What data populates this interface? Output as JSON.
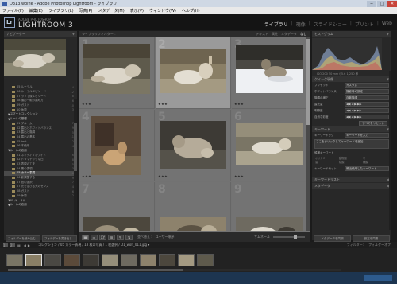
{
  "window": {
    "title": "D313.wolfie - Adobe Photoshop Lightroom - ライブラリ",
    "minimize": "─",
    "maximize": "□",
    "close": "✕"
  },
  "menu": [
    "ファイル(F)",
    "編集(E)",
    "ライブラリ(L)",
    "写真(P)",
    "メタデータ(M)",
    "表示(V)",
    "ウィンドウ(W)",
    "ヘルプ(H)"
  ],
  "identity": {
    "badge": "Lr",
    "vendor": "ADOBE PHOTOSHOP",
    "product": "LIGHTROOM 3"
  },
  "modules": [
    {
      "label": "ライブラリ",
      "active": true
    },
    {
      "label": "現像",
      "active": false
    },
    {
      "label": "スライドショー",
      "active": false
    },
    {
      "label": "プリント",
      "active": false
    },
    {
      "label": "Web",
      "active": false
    }
  ],
  "left_panel": {
    "navigator_title": "ナビゲーター",
    "folders": [
      {
        "label": "05 ルーラル",
        "count": "4",
        "kind": "folder"
      },
      {
        "label": "06 ルーラルエビゾード",
        "count": "12",
        "kind": "folder"
      },
      {
        "label": "07 ラフで後エビゾード",
        "count": "8",
        "kind": "folder"
      },
      {
        "label": "08 撮影一眼の始め方",
        "count": "6",
        "kind": "folder"
      },
      {
        "label": "09 ガスト",
        "count": "10",
        "kind": "folder"
      },
      {
        "label": "10 休憩",
        "count": "3",
        "kind": "folder"
      },
      {
        "label": "スマートコレクション",
        "count": "",
        "kind": "group"
      },
      {
        "label": "ルールの基礎",
        "count": "",
        "kind": "group"
      },
      {
        "label": "01 ブルーム",
        "count": "7",
        "kind": "folder"
      },
      {
        "label": "02 露出とホワイトバランス",
        "count": "9",
        "kind": "folder"
      },
      {
        "label": "03 露出と階調",
        "count": "5",
        "kind": "folder"
      },
      {
        "label": "04 露出の基本",
        "count": "11",
        "kind": "folder"
      },
      {
        "label": "05 text",
        "count": "2",
        "kind": "folder"
      },
      {
        "label": "06 本使用",
        "count": "4",
        "kind": "folder"
      },
      {
        "label": "ルールの応用",
        "count": "",
        "kind": "group"
      },
      {
        "label": "01 ネイティブホワイト",
        "count": "6",
        "kind": "folder"
      },
      {
        "label": "02 ドラマチックな白",
        "count": "8",
        "kind": "folder"
      },
      {
        "label": "03 表現の工夫",
        "count": "5",
        "kind": "folder"
      },
      {
        "label": "04 黒の表現",
        "count": "3",
        "kind": "folder"
      },
      {
        "label": "05 カラー表現",
        "count": "18",
        "kind": "folder",
        "selected": true
      },
      {
        "label": "06 影調整する",
        "count": "9",
        "kind": "folder"
      },
      {
        "label": "07 色の選択",
        "count": "7",
        "kind": "folder"
      },
      {
        "label": "07 光を浴びる光のセンス",
        "count": "4",
        "kind": "folder"
      },
      {
        "label": "08 ガスト",
        "count": "6",
        "kind": "folder"
      },
      {
        "label": "09 休憩",
        "count": "2",
        "kind": "folder"
      },
      {
        "label": "01 ルーラル",
        "count": "",
        "kind": "group"
      },
      {
        "label": "ルールの応用",
        "count": "",
        "kind": "group"
      }
    ],
    "import_button": "フォルダーを読み込む...",
    "export_button": "フォルダーを書き出し..."
  },
  "center": {
    "filter_title": "ライブラリフィルター :",
    "filter_tabs": [
      {
        "label": "テキスト",
        "on": false
      },
      {
        "label": "属性",
        "on": false
      },
      {
        "label": "メタデータ",
        "on": false
      },
      {
        "label": "なし",
        "on": true
      }
    ],
    "filter_right": "フィルターオフ",
    "cells": [
      {
        "num": "1",
        "selected": false,
        "stars": "★★★"
      },
      {
        "num": "2",
        "selected": true,
        "stars": "★★★"
      },
      {
        "num": "3",
        "selected": false,
        "stars": "★★★"
      },
      {
        "num": "4",
        "selected": false,
        "stars": "★★★"
      },
      {
        "num": "5",
        "selected": false,
        "stars": "★★★"
      },
      {
        "num": "6",
        "selected": false,
        "stars": "★★★"
      },
      {
        "num": "7",
        "selected": false,
        "stars": ""
      },
      {
        "num": "8",
        "selected": false,
        "stars": ""
      },
      {
        "num": "9",
        "selected": false,
        "stars": ""
      }
    ],
    "toolbar": {
      "sort_label": "並べ替え :",
      "sort_value": "ユーザー順序",
      "thumbnails_label": "サムネール"
    }
  },
  "right_panel": {
    "histogram_title": "ヒストグラム",
    "histogram_info": "ISO 200   50 mm   f/5.6   1/250 秒",
    "quick_develop_title": "クイック現像",
    "preset_label": "プリセット",
    "preset_value": "カスタム",
    "wb_label": "ホワイトバランス",
    "wb_value": "撮影時の設定",
    "tone_label": "階調の補正",
    "auto_tone": "自動階調",
    "quick_rows": [
      "露光量",
      "明瞭度",
      "自然な彩度"
    ],
    "reset_button": "すべてをリセット",
    "keywording_title": "キーワード",
    "keyword_tags_label": "キーワードタグ",
    "keyword_tags_value": "キーワードを入力",
    "keyword_hint": "ここをクリックしてキーワードを追加",
    "keyword_suggestions_label": "候補キーワード",
    "keyword_suggestions": [
      "オオカミ",
      "動物園",
      "冬",
      "雪",
      "寝顔",
      "横顔"
    ],
    "keyword_set_label": "キーワードセット",
    "keyword_set_value": "最近使用したキーワード",
    "keyword_list_title": "キーワードリスト",
    "metadata_title": "メタデータ",
    "sync_meta": "メタデータを同期",
    "sync_settings": "設定を同期"
  },
  "filmbar": {
    "mode_buttons": [
      "1",
      "2"
    ],
    "path": "コレクション / 05 カラー表現 / 18 枚の写真 / 1 枚選択 / D1_wolf_011.jpg ▾",
    "filter_label": "フィルター:",
    "filter_value": "フィルターオフ"
  },
  "filmstrip": {
    "thumb_count": 11,
    "selected_index": 1
  },
  "taskbar": {}
}
